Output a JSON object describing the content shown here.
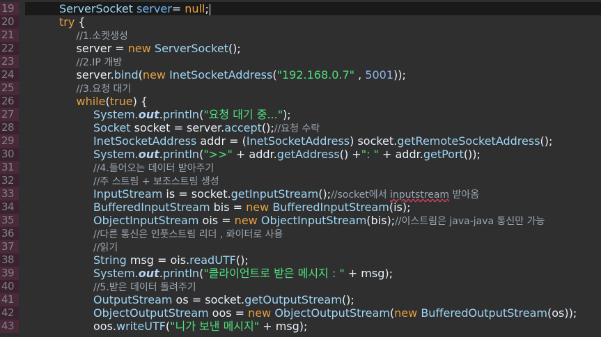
{
  "gutter": {
    "line_numbers": [
      "19",
      "20",
      "21",
      "22",
      "23",
      "24",
      "25",
      "26",
      "27",
      "28",
      "29",
      "30",
      "31",
      "32",
      "33",
      "34",
      "35",
      "36",
      "37",
      "38",
      "39",
      "40",
      "41",
      "42",
      "43"
    ]
  },
  "editor": {
    "lines": [
      {
        "indent": 2,
        "tokens": [
          [
            "t-type",
            "ServerSocket"
          ],
          [
            "t-plain",
            " "
          ],
          [
            "t-field",
            "server"
          ],
          [
            "t-plain",
            "= "
          ],
          [
            "t-kw",
            "null"
          ],
          [
            "t-plain",
            ";"
          ]
        ],
        "caret": true
      },
      {
        "indent": 2,
        "tokens": [
          [
            "t-kw",
            "try"
          ],
          [
            "t-plain",
            " {"
          ]
        ]
      },
      {
        "indent": 3,
        "tokens": [
          [
            "t-cmt",
            "//1.소켓생성"
          ]
        ]
      },
      {
        "indent": 3,
        "tokens": [
          [
            "t-plain",
            "server = "
          ],
          [
            "t-kw",
            "new"
          ],
          [
            "t-plain",
            " "
          ],
          [
            "t-type",
            "ServerSocket"
          ],
          [
            "t-plain",
            "();"
          ]
        ]
      },
      {
        "indent": 3,
        "tokens": [
          [
            "t-cmt",
            "//2.IP 개방"
          ]
        ]
      },
      {
        "indent": 3,
        "tokens": [
          [
            "t-plain",
            "server."
          ],
          [
            "t-type",
            "bind"
          ],
          [
            "t-plain",
            "("
          ],
          [
            "t-kw",
            "new"
          ],
          [
            "t-plain",
            " "
          ],
          [
            "t-type",
            "InetSocketAddress"
          ],
          [
            "t-plain",
            "("
          ],
          [
            "t-str",
            "\"192.168.0.7\""
          ],
          [
            "t-plain",
            " , "
          ],
          [
            "t-num",
            "5001"
          ],
          [
            "t-plain",
            "));"
          ]
        ]
      },
      {
        "indent": 3,
        "tokens": [
          [
            "t-cmt",
            "//3.요청 대기"
          ]
        ]
      },
      {
        "indent": 3,
        "tokens": [
          [
            "t-kw",
            "while"
          ],
          [
            "t-plain",
            "("
          ],
          [
            "t-kw",
            "true"
          ],
          [
            "t-plain",
            ") {"
          ]
        ]
      },
      {
        "indent": 4,
        "tokens": [
          [
            "t-type",
            "System."
          ],
          [
            "t-fld",
            "out"
          ],
          [
            "t-plain",
            "."
          ],
          [
            "t-type",
            "println"
          ],
          [
            "t-plain",
            "("
          ],
          [
            "t-str",
            "\"요청 대기 중...\""
          ],
          [
            "t-plain",
            ");"
          ]
        ]
      },
      {
        "indent": 4,
        "tokens": [
          [
            "t-type",
            "Socket"
          ],
          [
            "t-plain",
            " socket = server."
          ],
          [
            "t-type",
            "accept"
          ],
          [
            "t-plain",
            "();"
          ],
          [
            "t-cmt",
            "//요청 수락"
          ]
        ]
      },
      {
        "indent": 4,
        "tokens": [
          [
            "t-type",
            "InetSocketAddress"
          ],
          [
            "t-plain",
            " addr = ("
          ],
          [
            "t-type",
            "InetSocketAddress"
          ],
          [
            "t-plain",
            ") socket."
          ],
          [
            "t-type",
            "getRemoteSocketAddress"
          ],
          [
            "t-plain",
            "();"
          ]
        ]
      },
      {
        "indent": 4,
        "tokens": [
          [
            "t-type",
            "System."
          ],
          [
            "t-fld",
            "out"
          ],
          [
            "t-plain",
            "."
          ],
          [
            "t-type",
            "println"
          ],
          [
            "t-plain",
            "("
          ],
          [
            "t-str",
            "\">>\""
          ],
          [
            "t-plain",
            " + addr."
          ],
          [
            "t-type",
            "getAddress"
          ],
          [
            "t-plain",
            "() +"
          ],
          [
            "t-str",
            "\": \""
          ],
          [
            "t-plain",
            " + addr."
          ],
          [
            "t-type",
            "getPort"
          ],
          [
            "t-plain",
            "());"
          ]
        ]
      },
      {
        "indent": 4,
        "tokens": [
          [
            "t-cmt",
            "//4.들어오는 데이터 받아주기"
          ]
        ]
      },
      {
        "indent": 4,
        "tokens": [
          [
            "t-cmt",
            "//주 스트림 + 보조스트림 생성"
          ]
        ]
      },
      {
        "indent": 4,
        "tokens": [
          [
            "t-type",
            "InputStream"
          ],
          [
            "t-plain",
            " is = socket."
          ],
          [
            "t-type",
            "getInputStream"
          ],
          [
            "t-plain",
            "();"
          ],
          [
            "t-cmt",
            "//socket에서 "
          ],
          [
            "t-cmt squiggle",
            "inputstream"
          ],
          [
            "t-cmt",
            " 받아옴"
          ]
        ]
      },
      {
        "indent": 4,
        "tokens": [
          [
            "t-type",
            "BufferedInputStream"
          ],
          [
            "t-plain",
            " bis = "
          ],
          [
            "t-kw",
            "new"
          ],
          [
            "t-plain",
            " "
          ],
          [
            "t-type",
            "BufferedInputStream"
          ],
          [
            "t-plain",
            "(is);"
          ]
        ]
      },
      {
        "indent": 4,
        "tokens": [
          [
            "t-type",
            "ObjectInputStream"
          ],
          [
            "t-plain",
            " ois = "
          ],
          [
            "t-kw",
            "new"
          ],
          [
            "t-plain",
            " "
          ],
          [
            "t-type",
            "ObjectInputStream"
          ],
          [
            "t-plain",
            "(bis);"
          ],
          [
            "t-cmt",
            "//이스트림은 java-java 통신만 가능"
          ]
        ]
      },
      {
        "indent": 4,
        "tokens": [
          [
            "t-cmt",
            "//다른 통신은 인풋스트림 리더 , 롸이터로 사용"
          ]
        ]
      },
      {
        "indent": 4,
        "tokens": [
          [
            "t-cmt",
            "//읽기"
          ]
        ]
      },
      {
        "indent": 4,
        "tokens": [
          [
            "t-type",
            "String"
          ],
          [
            "t-plain",
            " msg = ois."
          ],
          [
            "t-type",
            "readUTF"
          ],
          [
            "t-plain",
            "();"
          ]
        ]
      },
      {
        "indent": 4,
        "tokens": [
          [
            "t-type",
            "System."
          ],
          [
            "t-fld",
            "out"
          ],
          [
            "t-plain",
            "."
          ],
          [
            "t-type",
            "println"
          ],
          [
            "t-plain",
            "("
          ],
          [
            "t-str",
            "\"클라이언트로 받은 메시지 : \""
          ],
          [
            "t-plain",
            " + msg);"
          ]
        ]
      },
      {
        "indent": 4,
        "tokens": [
          [
            "t-cmt",
            "//5.받은 데이터 돌려주기"
          ]
        ]
      },
      {
        "indent": 4,
        "tokens": [
          [
            "t-type",
            "OutputStream"
          ],
          [
            "t-plain",
            " os = socket."
          ],
          [
            "t-type",
            "getOutputStream"
          ],
          [
            "t-plain",
            "();"
          ]
        ]
      },
      {
        "indent": 4,
        "tokens": [
          [
            "t-type",
            "ObjectOutputStream"
          ],
          [
            "t-plain",
            " oos = "
          ],
          [
            "t-kw",
            "new"
          ],
          [
            "t-plain",
            " "
          ],
          [
            "t-type",
            "ObjectOutputStream"
          ],
          [
            "t-plain",
            "("
          ],
          [
            "t-kw",
            "new"
          ],
          [
            "t-plain",
            " "
          ],
          [
            "t-type",
            "BufferedOutputStream"
          ],
          [
            "t-plain",
            "(os));"
          ]
        ]
      },
      {
        "indent": 4,
        "tokens": [
          [
            "t-plain",
            "oos."
          ],
          [
            "t-type",
            "writeUTF"
          ],
          [
            "t-plain",
            "("
          ],
          [
            "t-str",
            "\"니가 보낸 메시지\""
          ],
          [
            "t-plain",
            " + msg);"
          ]
        ]
      }
    ]
  }
}
